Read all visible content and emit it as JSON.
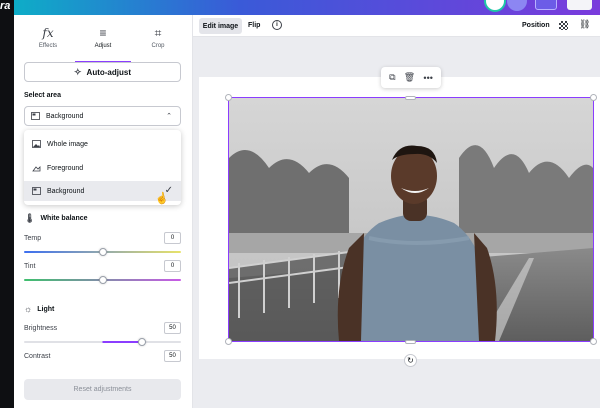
{
  "topbar": {
    "brand_letters": "ra"
  },
  "panel": {
    "tabs": [
      {
        "label": "Effects",
        "icon": "fx-icon",
        "glyph": "fx"
      },
      {
        "label": "Adjust",
        "icon": "sliders-icon",
        "glyph": "≡"
      },
      {
        "label": "Crop",
        "icon": "crop-icon",
        "glyph": "⌗"
      }
    ],
    "active_tab": "Adjust",
    "auto_adjust_label": "Auto-adjust",
    "select_area": {
      "label": "Select area",
      "selected": "Background",
      "options": [
        "Whole image",
        "Foreground",
        "Background"
      ]
    },
    "white_balance": {
      "title": "White balance",
      "temp": {
        "label": "Temp",
        "value": "0",
        "level": 0.5
      },
      "tint": {
        "label": "Tint",
        "value": "0",
        "level": 0.5
      }
    },
    "light": {
      "title": "Light",
      "brightness": {
        "label": "Brightness",
        "value": "50",
        "level": 0.75
      },
      "contrast": {
        "label": "Contrast",
        "value": "50"
      }
    },
    "reset_label": "Reset adjustments"
  },
  "toolbar": {
    "edit_image": "Edit image",
    "flip": "Flip",
    "info": "i",
    "position": "Position"
  },
  "float_toolbar": [
    "copy-icon",
    "trash-icon",
    "more-icon"
  ],
  "colors": {
    "accent": "#8b3dff",
    "temp_gradient": [
      "#3d6ff0",
      "#e8e36a"
    ],
    "tint_gradient": [
      "#3fbf6e",
      "#c85be6"
    ]
  }
}
